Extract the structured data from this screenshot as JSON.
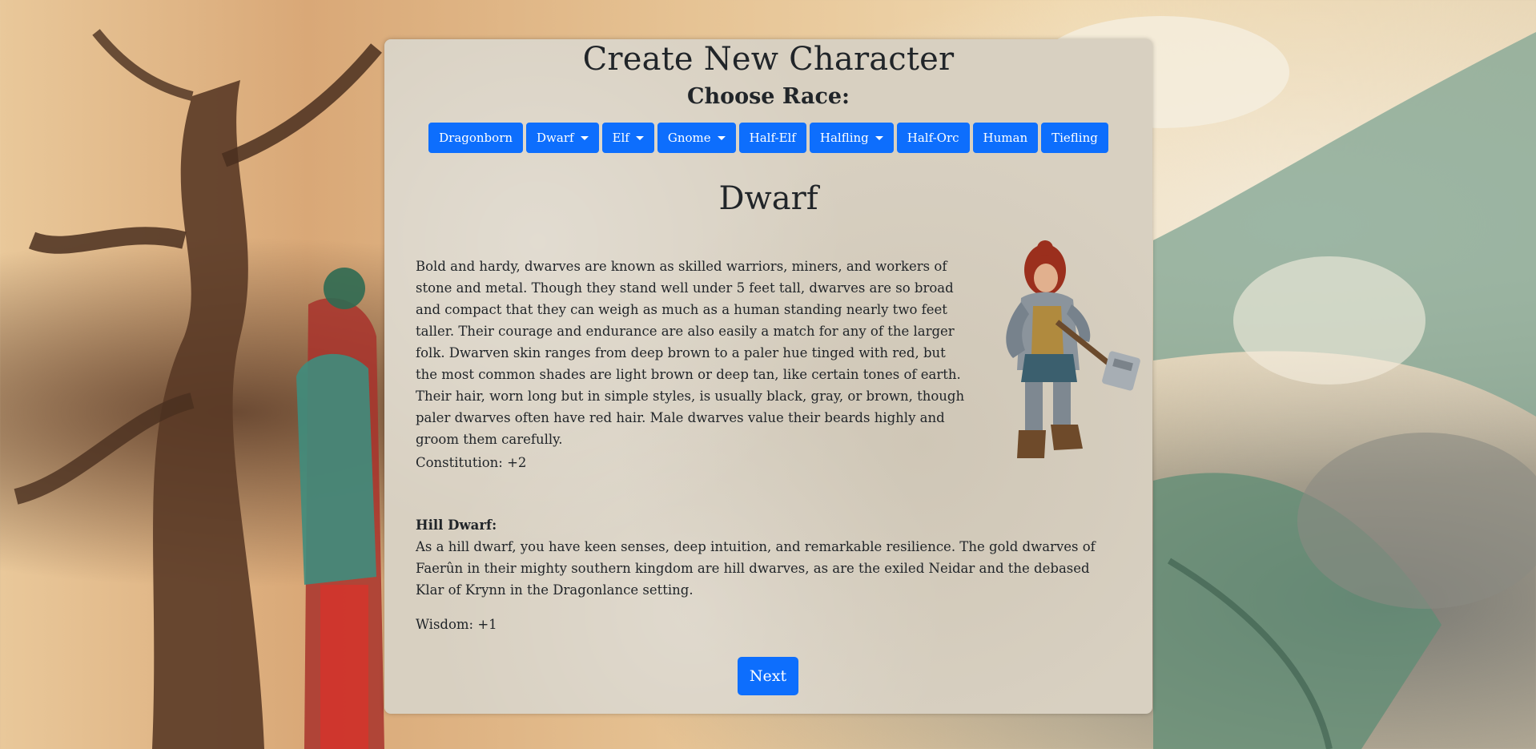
{
  "page": {
    "title": "Create New Character",
    "subtitle": "Choose Race:"
  },
  "races": [
    {
      "label": "Dragonborn",
      "dropdown": false
    },
    {
      "label": "Dwarf",
      "dropdown": true
    },
    {
      "label": "Elf",
      "dropdown": true
    },
    {
      "label": "Gnome",
      "dropdown": true
    },
    {
      "label": "Half-Elf",
      "dropdown": false
    },
    {
      "label": "Halfling",
      "dropdown": true
    },
    {
      "label": "Half-Orc",
      "dropdown": false
    },
    {
      "label": "Human",
      "dropdown": false
    },
    {
      "label": "Tiefling",
      "dropdown": false
    }
  ],
  "selected_race": {
    "name": "Dwarf",
    "description": "Bold and hardy, dwarves are known as skilled warriors, miners, and workers of stone and metal. Though they stand well under 5 feet tall, dwarves are so broad and compact that they can weigh as much as a human standing nearly two feet taller. Their courage and endurance are also easily a match for any of the larger folk. Dwarven skin ranges from deep brown to a paler hue tinged with red, but the most common shades are light brown or deep tan, like certain tones of earth. Their hair, worn long but in simple styles, is usually black, gray, or brown, though paler dwarves often have red hair. Male dwarves value their beards highly and groom them carefully.",
    "ability_bonus": "Constitution: +2",
    "portrait_icon": "dwarf-warrior-portrait"
  },
  "subrace": {
    "name": "Hill Dwarf:",
    "description": "As a hill dwarf, you have keen senses, deep intuition, and remarkable resilience. The gold dwarves of Faerûn in their mighty southern kingdom are hill dwarves, as are the exiled Neidar and the debased Klar of Krynn in the Dragonlance setting.",
    "ability_bonus": "Wisdom: +1"
  },
  "actions": {
    "next_label": "Next"
  },
  "colors": {
    "primary": "#0d6efd",
    "panel": "#d8d0c1",
    "text": "#212529"
  }
}
